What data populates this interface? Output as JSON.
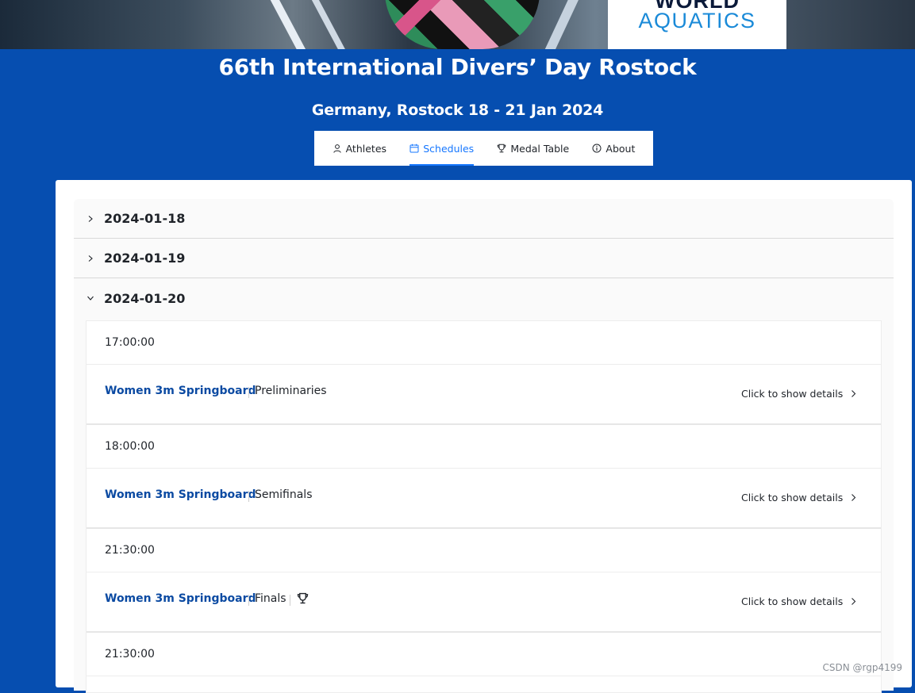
{
  "logo": {
    "line1": "WORLD",
    "line2": "AQUATICS"
  },
  "header": {
    "title": "66th International Divers’ Day Rostock",
    "subtitle": "Germany, Rostock 18 - 21 Jan 2024"
  },
  "tabs": [
    {
      "label": "Athletes",
      "icon": "user-icon"
    },
    {
      "label": "Schedules",
      "icon": "calendar-icon",
      "active": true
    },
    {
      "label": "Medal Table",
      "icon": "trophy-icon"
    },
    {
      "label": "About",
      "icon": "info-icon"
    }
  ],
  "accent_color": "#1677ff",
  "brand_color": "#064eb0",
  "days": [
    {
      "date": "2024-01-18",
      "expanded": false
    },
    {
      "date": "2024-01-19",
      "expanded": false
    },
    {
      "date": "2024-01-20",
      "expanded": true
    }
  ],
  "schedule": [
    {
      "time": "17:00:00",
      "event": "Women 3m Springboard",
      "phase": "Preliminaries",
      "details": "Click to show details",
      "medal": false
    },
    {
      "time": "18:00:00",
      "event": "Women 3m Springboard",
      "phase": "Semifinals",
      "details": "Click to show details",
      "medal": false
    },
    {
      "time": "21:30:00",
      "event": "Women 3m Springboard",
      "phase": "Finals",
      "details": "Click to show details",
      "medal": true
    },
    {
      "time": "21:30:00"
    }
  ],
  "watermark": "CSDN @rgp4199"
}
